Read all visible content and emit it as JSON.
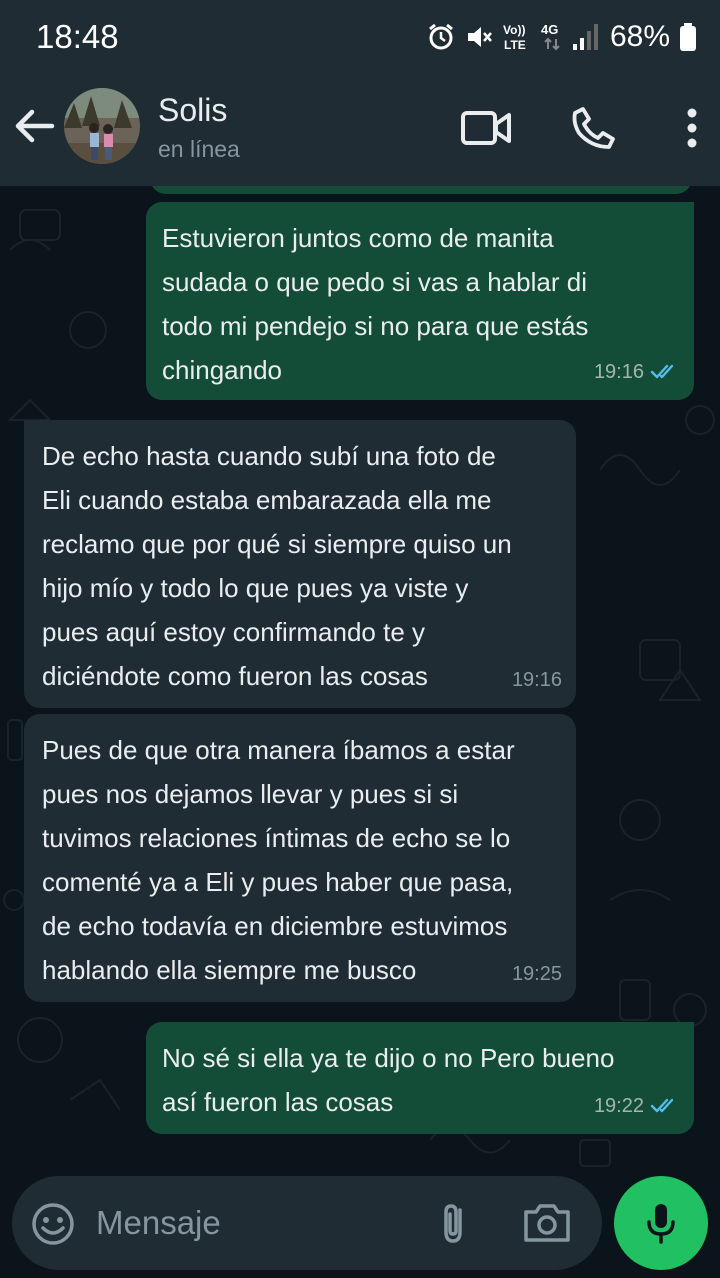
{
  "status_bar": {
    "time": "18:48",
    "battery": "68%",
    "icons": [
      "alarm-icon",
      "mute-icon",
      "volte-icon",
      "4g-icon",
      "signal-icon",
      "battery-icon"
    ]
  },
  "header": {
    "contact_name": "Solis",
    "contact_status": "en línea",
    "icons": [
      "back-arrow-icon",
      "video-call-icon",
      "phone-icon",
      "more-vert-icon"
    ]
  },
  "messages": [
    {
      "direction": "outgoing",
      "text": "Estuvieron juntos como de manita\nsudada o que pedo si vas a hablar di\ntodo mi pendejo si no para que estás\nchingando",
      "time": "19:16",
      "read": true
    },
    {
      "direction": "incoming",
      "text": "De echo hasta cuando subí una foto de\nEli cuando estaba embarazada ella me\nreclamo que por qué si siempre quiso un\nhijo mío y todo lo que pues ya viste y\npues aquí estoy confirmando te y\ndiciéndote como fueron las cosas",
      "time": "19:16"
    },
    {
      "direction": "incoming",
      "text": "Pues de que otra manera íbamos a estar\npues nos dejamos llevar y pues si si\ntuvimos relaciones íntimas de echo se lo\ncomenté ya a Eli y pues haber que pasa,\nde echo todavía en diciembre estuvimos\nhablando ella siempre me busco",
      "time": "19:25"
    },
    {
      "direction": "outgoing",
      "text": "No sé si ella ya te dijo o no Pero bueno\nasí fueron las cosas",
      "time": "19:22",
      "read": true
    }
  ],
  "input": {
    "placeholder": "Mensaje",
    "icons": [
      "emoji-icon",
      "attach-icon",
      "camera-icon",
      "mic-icon"
    ]
  },
  "colors": {
    "background": "#0b141a",
    "header": "#1f2c34",
    "outgoing_bubble": "#144d37",
    "incoming_bubble": "#202c33",
    "read_ticks": "#53bdeb",
    "accent_green": "#21c063"
  }
}
